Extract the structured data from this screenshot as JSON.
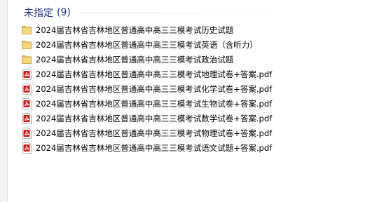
{
  "group": {
    "label": "未指定",
    "count": "(9)"
  },
  "files": [
    {
      "name": "2024届吉林省吉林地区普通高中高三三模考试历史试题",
      "icon": "folder-icon"
    },
    {
      "name": "2024届吉林省吉林地区普通高中高三三模考试英语（含听力）",
      "icon": "folder-icon"
    },
    {
      "name": "2024届吉林省吉林地区普通高中高三三模考试政治试题",
      "icon": "folder-icon"
    },
    {
      "name": "2024届吉林省吉林地区普通高中高三三模考试地理试卷+答案.pdf",
      "icon": "pdf-icon"
    },
    {
      "name": "2024届吉林省吉林地区普通高中高三三模考试化学试卷+答案.pdf",
      "icon": "pdf-icon"
    },
    {
      "name": "2024届吉林省吉林地区普通高中高三三模考试生物试卷+答案.pdf",
      "icon": "pdf-icon"
    },
    {
      "name": "2024届吉林省吉林地区普通高中高三三模考试数学试卷+答案.pdf",
      "icon": "pdf-icon"
    },
    {
      "name": "2024届吉林省吉林地区普通高中高三三模考试物理试卷+答案.pdf",
      "icon": "pdf-icon"
    },
    {
      "name": "2024届吉林省吉林地区普通高中高三三模考试语文试题+答案.pdf",
      "icon": "pdf-icon"
    }
  ],
  "colors": {
    "group_header": "#1e3287",
    "folder": "#e8c25a",
    "pdf_red": "#c8201e"
  }
}
